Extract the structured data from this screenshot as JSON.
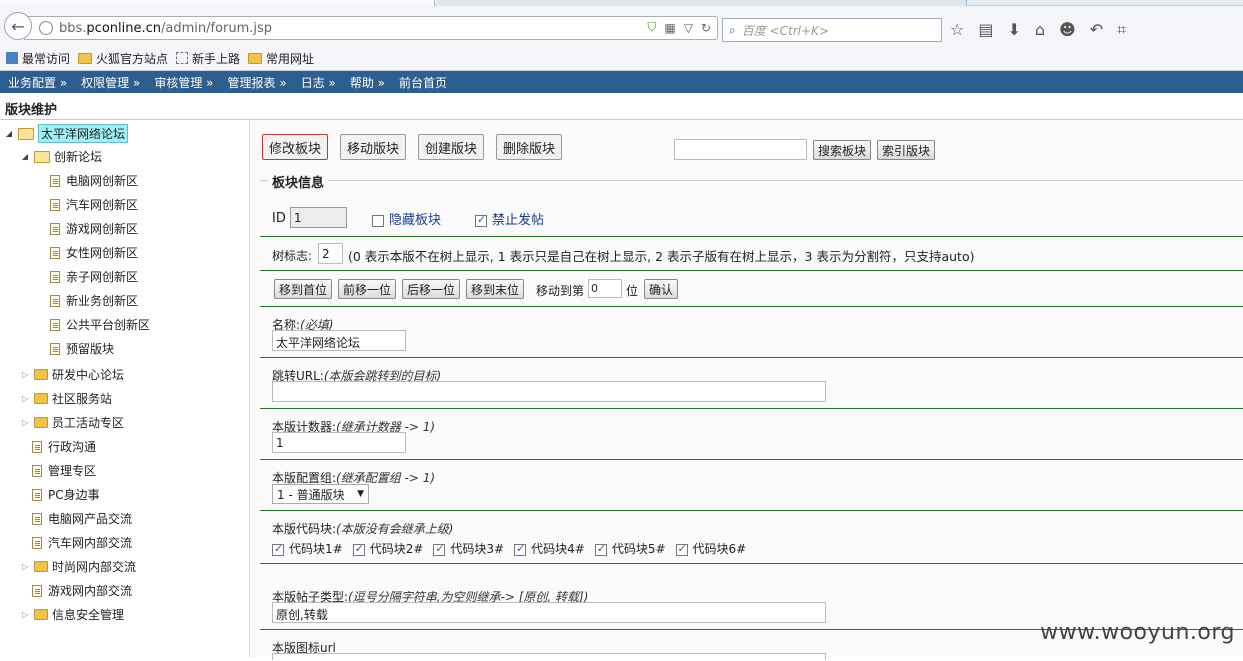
{
  "browser": {
    "url_prefix": "bbs.",
    "url_domain": "pconline.cn",
    "url_path": "/admin/forum.jsp",
    "search_placeholder": "百度 <Ctrl+K>",
    "bookmarks": [
      "最常访问",
      "火狐官方站点",
      "新手上路",
      "常用网址"
    ]
  },
  "menu": [
    "业务配置 »",
    "权限管理 »",
    "审核管理 »",
    "管理报表 »",
    "日志 »",
    "帮助 »",
    "前台首页"
  ],
  "page_title": "版块维护",
  "tree": [
    {
      "label": "太平洋网络论坛",
      "level": 0,
      "type": "open",
      "selected": true
    },
    {
      "label": "创新论坛",
      "level": 1,
      "type": "open"
    },
    {
      "label": "电脑网创新区",
      "level": 2,
      "type": "doc"
    },
    {
      "label": "汽车网创新区",
      "level": 2,
      "type": "doc"
    },
    {
      "label": "游戏网创新区",
      "level": 2,
      "type": "doc"
    },
    {
      "label": "女性网创新区",
      "level": 2,
      "type": "doc"
    },
    {
      "label": "亲子网创新区",
      "level": 2,
      "type": "doc"
    },
    {
      "label": "新业务创新区",
      "level": 2,
      "type": "doc"
    },
    {
      "label": "公共平台创新区",
      "level": 2,
      "type": "doc"
    },
    {
      "label": "预留版块",
      "level": 2,
      "type": "doc"
    },
    {
      "label": "研发中心论坛",
      "level": 1,
      "type": "closed"
    },
    {
      "label": "社区服务站",
      "level": 1,
      "type": "closed"
    },
    {
      "label": "员工活动专区",
      "level": 1,
      "type": "closed"
    },
    {
      "label": "行政沟通",
      "level": 1,
      "type": "doc"
    },
    {
      "label": "管理专区",
      "level": 1,
      "type": "doc"
    },
    {
      "label": "PC身边事",
      "level": 1,
      "type": "doc"
    },
    {
      "label": "电脑网产品交流",
      "level": 1,
      "type": "doc"
    },
    {
      "label": "汽车网内部交流",
      "level": 1,
      "type": "doc"
    },
    {
      "label": "时尚网内部交流",
      "level": 1,
      "type": "closed"
    },
    {
      "label": "游戏网内部交流",
      "level": 1,
      "type": "doc"
    },
    {
      "label": "信息安全管理",
      "level": 1,
      "type": "closed"
    }
  ],
  "actions": {
    "edit": "修改板块",
    "move": "移动版块",
    "create": "创建版块",
    "delete": "删除版块",
    "search": "搜索板块",
    "index": "索引版块"
  },
  "form": {
    "legend": "板块信息",
    "id_label": "ID",
    "id_value": "1",
    "hidden_label": "隐藏板块",
    "hidden_checked": false,
    "noPost_label": "禁止发帖",
    "noPost_checked": true,
    "tree_flag_label": "树标志:",
    "tree_flag_value": "2",
    "tree_flag_desc": "(0 表示本版不在树上显示, 1 表示只是自己在树上显示, 2 表示子版有在树上显示，3 表示为分割符，只支持auto)",
    "move_first": "移到首位",
    "move_prev": "前移一位",
    "move_next": "后移一位",
    "move_last": "移到末位",
    "move_to_label": "移动到第",
    "move_to_value": "0",
    "move_to_unit": "位",
    "confirm": "确认",
    "name_label": "名称:",
    "name_hint": "(必填)",
    "name_value": "太平洋网络论坛",
    "url_label": "跳转URL:",
    "url_hint": "(本版会跳转到的目标)",
    "url_value": "",
    "counter_label": "本版计数器:",
    "counter_hint": "(继承计数器 -> 1)",
    "counter_value": "1",
    "config_label": "本版配置组:",
    "config_hint": "(继承配置组 -> 1)",
    "config_value": "1 - 普通版块",
    "code_label": "本版代码块:",
    "code_hint": "(本版没有会继承上级)",
    "code_blocks": [
      "代码块1#",
      "代码块2#",
      "代码块3#",
      "代码块4#",
      "代码块5#",
      "代码块6#"
    ],
    "post_type_label": "本版帖子类型:",
    "post_type_hint": "(逗号分隔字符串,为空则继承-> [原创, 转载])",
    "post_type_value": "原创,转载",
    "icon_url_label": "本版图标url"
  },
  "watermark": "www.wooyun.org"
}
